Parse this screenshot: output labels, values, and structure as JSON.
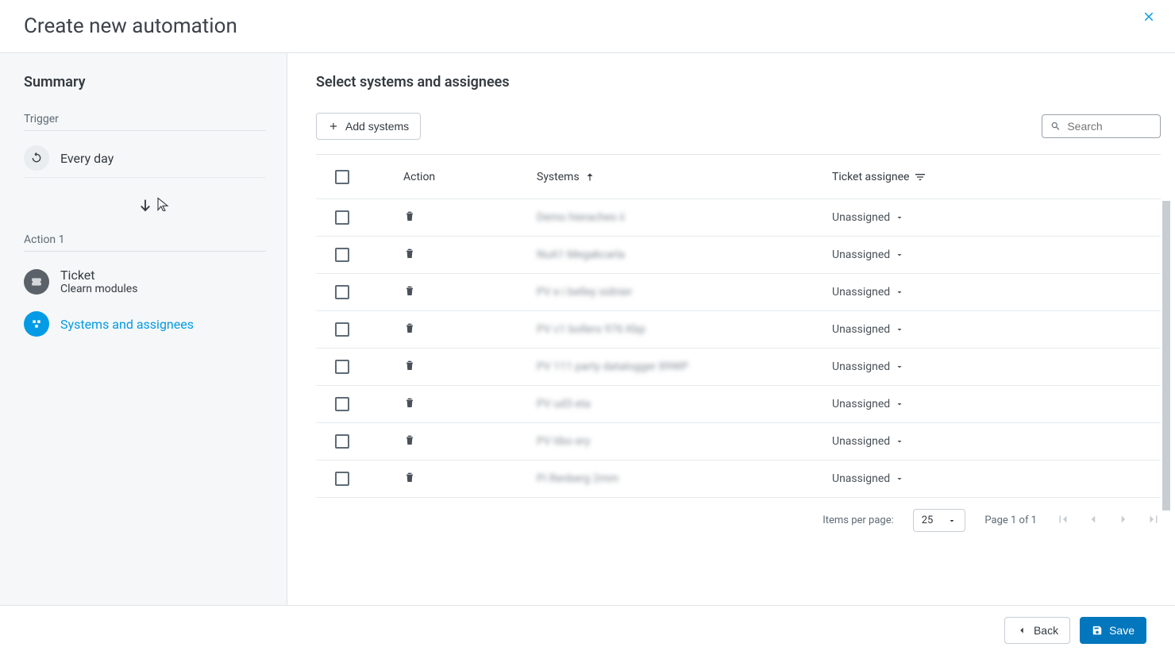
{
  "header": {
    "title": "Create new automation"
  },
  "sidebar": {
    "title": "Summary",
    "trigger_label": "Trigger",
    "trigger_value": "Every day",
    "action_label": "Action 1",
    "items": [
      {
        "name": "Ticket",
        "subtitle": "Clearn modules",
        "icon": "ticket-icon",
        "active": false
      },
      {
        "name": "Systems and assignees",
        "subtitle": "",
        "icon": "flow-icon",
        "active": true
      }
    ]
  },
  "main": {
    "title": "Select systems and assignees",
    "add_button": "Add systems",
    "search_placeholder": "Search",
    "columns": {
      "action": "Action",
      "systems": "Systems",
      "assignee": "Ticket assignee"
    },
    "rows": [
      {
        "system": "Demo hieraches ii",
        "assignee": "Unassigned"
      },
      {
        "system": "NuA1 Megakcarla",
        "assignee": "Unassigned"
      },
      {
        "system": "PV e i belley sidnier",
        "assignee": "Unassigned"
      },
      {
        "system": "PV c1 bollers 976 Kbp",
        "assignee": "Unassigned"
      },
      {
        "system": "PV 111 party datalogger 89WP",
        "assignee": "Unassigned"
      },
      {
        "system": "PV ud3 eta",
        "assignee": "Unassigned"
      },
      {
        "system": "PV tibo ery",
        "assignee": "Unassigned"
      },
      {
        "system": "Pi Renberg 2mm",
        "assignee": "Unassigned"
      }
    ],
    "pagination": {
      "items_per_page_label": "Items per page:",
      "items_per_page_value": "25",
      "page_text": "Page 1 of 1"
    }
  },
  "footer": {
    "back": "Back",
    "save": "Save"
  }
}
